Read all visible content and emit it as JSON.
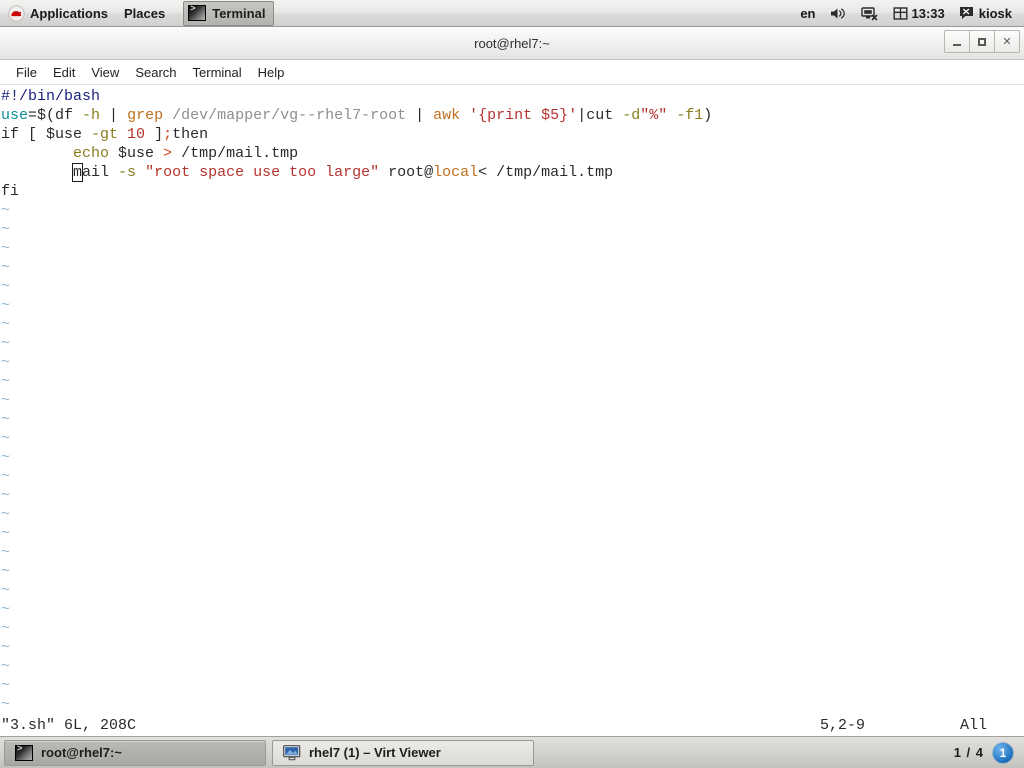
{
  "top_panel": {
    "applications_label": "Applications",
    "places_label": "Places",
    "task_terminal": "Terminal",
    "keyboard_layout": "en",
    "clock": "13:33",
    "user": "kiosk",
    "icons": {
      "redhat": "redhat-logo-icon",
      "terminal": "terminal-icon",
      "volume": "volume-icon",
      "network": "network-disconnected-icon",
      "calendar": "calendar-icon",
      "message": "message-icon"
    }
  },
  "window": {
    "title": "root@rhel7:~",
    "controls": {
      "minimize": "_",
      "maximize": "□",
      "close": "✕"
    },
    "menu": [
      "File",
      "Edit",
      "View",
      "Search",
      "Terminal",
      "Help"
    ]
  },
  "editor": {
    "lines": [
      {
        "n": 1,
        "tokens": [
          {
            "t": "#!/bin/bash",
            "c": "c-comment"
          }
        ]
      },
      {
        "n": 2,
        "tokens": [
          {
            "t": "use",
            "c": "c-ident"
          },
          {
            "t": "=$(df ",
            "c": "c-plain"
          },
          {
            "t": "-h",
            "c": "c-opt"
          },
          {
            "t": " | ",
            "c": "c-plain"
          },
          {
            "t": "grep",
            "c": "c-cmd"
          },
          {
            "t": " /dev/mapper/vg--rhel7-root",
            "c": "c-path"
          },
          {
            "t": " | ",
            "c": "c-plain"
          },
          {
            "t": "awk",
            "c": "c-cmd"
          },
          {
            "t": " ",
            "c": "c-plain"
          },
          {
            "t": "'{print $5}'",
            "c": "c-str"
          },
          {
            "t": "|cut ",
            "c": "c-plain"
          },
          {
            "t": "-d",
            "c": "c-opt"
          },
          {
            "t": "\"%\"",
            "c": "c-str"
          },
          {
            "t": " ",
            "c": "c-plain"
          },
          {
            "t": "-f1",
            "c": "c-opt"
          },
          {
            "t": ")",
            "c": "c-plain"
          }
        ]
      },
      {
        "n": 3,
        "tokens": [
          {
            "t": "if [ $use ",
            "c": "c-plain"
          },
          {
            "t": "-gt",
            "c": "c-opt"
          },
          {
            "t": " ",
            "c": "c-plain"
          },
          {
            "t": "10",
            "c": "c-num"
          },
          {
            "t": " ]",
            "c": "c-plain"
          },
          {
            "t": ";",
            "c": "c-op"
          },
          {
            "t": "then",
            "c": "c-plain"
          }
        ]
      },
      {
        "n": 4,
        "tokens": [
          {
            "t": "        ",
            "c": "c-plain"
          },
          {
            "t": "echo",
            "c": "c-opt"
          },
          {
            "t": " $use ",
            "c": "c-plain"
          },
          {
            "t": ">",
            "c": "c-op"
          },
          {
            "t": " /tmp/mail.tmp",
            "c": "c-plain"
          }
        ]
      },
      {
        "n": 5,
        "tokens": [
          {
            "t": "        ",
            "c": "c-plain"
          },
          {
            "t": "m",
            "c": "c-plain",
            "cursor": true
          },
          {
            "t": "ail ",
            "c": "c-plain"
          },
          {
            "t": "-s",
            "c": "c-opt"
          },
          {
            "t": " ",
            "c": "c-plain"
          },
          {
            "t": "\"root space use too large\"",
            "c": "c-str"
          },
          {
            "t": " root@",
            "c": "c-plain"
          },
          {
            "t": "local",
            "c": "c-cmd"
          },
          {
            "t": "< /tmp/mail.tmp",
            "c": "c-plain"
          }
        ]
      },
      {
        "n": 6,
        "tokens": [
          {
            "t": "fi",
            "c": "c-plain"
          }
        ]
      }
    ],
    "empty_marker": "~",
    "empty_line_count": 27,
    "status": {
      "file": "\"3.sh\" 6L, 208C",
      "position": "5,2-9",
      "scroll": "All"
    }
  },
  "taskbar": {
    "items": [
      {
        "label": "root@rhel7:~",
        "icon": "terminal-icon",
        "active": true
      },
      {
        "label": "rhel7 (1) – Virt Viewer",
        "icon": "monitor-icon",
        "active": false
      }
    ],
    "workspace_label": "1 / 4",
    "workspace_number": "1"
  },
  "colors": {
    "panel_bg": "#dedcda",
    "terminal_bg": "#ffffff",
    "comment": "#1b247e",
    "string": "#b5332e",
    "identifier": "#0d8f96",
    "command": "#c07020",
    "option": "#8a7d1e",
    "tilde": "#8fb7d6",
    "workspace_accent": "#1d6fbd"
  }
}
